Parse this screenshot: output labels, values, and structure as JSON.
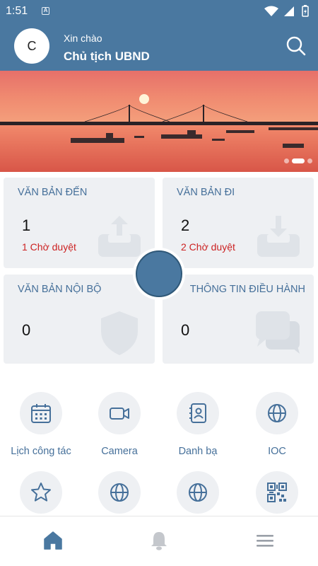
{
  "status_bar": {
    "time": "1:51",
    "notification_icon": "A"
  },
  "header": {
    "avatar_initial": "C",
    "greeting": "Xin chào",
    "role": "Chủ tịch UBND"
  },
  "banner": {
    "slides": 3,
    "active_slide": 2
  },
  "cards": [
    {
      "title": "VĂN BẢN ĐẾN",
      "count": "1",
      "pending": "1 Chờ duyệt",
      "icon": "inbox-upload-icon"
    },
    {
      "title": "VĂN BẢN ĐI",
      "count": "2",
      "pending": "2 Chờ duyệt",
      "icon": "inbox-download-icon"
    },
    {
      "title": "VĂN BẢN NỘI BỘ",
      "count": "0",
      "icon": "shield-icon"
    },
    {
      "title": "THÔNG TIN ĐIỀU HÀNH",
      "count": "0",
      "icon": "chat-icon"
    }
  ],
  "grid": [
    {
      "label": "Lịch công tác",
      "icon": "calendar-icon"
    },
    {
      "label": "Camera",
      "icon": "camera-icon"
    },
    {
      "label": "Danh bạ",
      "icon": "contacts-icon"
    },
    {
      "label": "IOC",
      "icon": "globe-icon"
    },
    {
      "label": "",
      "icon": "star-icon"
    },
    {
      "label": "",
      "icon": "globe-icon"
    },
    {
      "label": "",
      "icon": "globe-icon"
    },
    {
      "label": "",
      "icon": "qr-code-icon"
    }
  ],
  "bottom_nav": [
    {
      "name": "home",
      "icon": "home-icon",
      "active": true
    },
    {
      "name": "notifications",
      "icon": "bell-icon",
      "active": false
    },
    {
      "name": "menu",
      "icon": "menu-icon",
      "active": false
    }
  ],
  "colors": {
    "primary": "#4a78a0",
    "card_bg": "#eef0f3",
    "pending": "#cc2222",
    "label": "#46709a"
  }
}
